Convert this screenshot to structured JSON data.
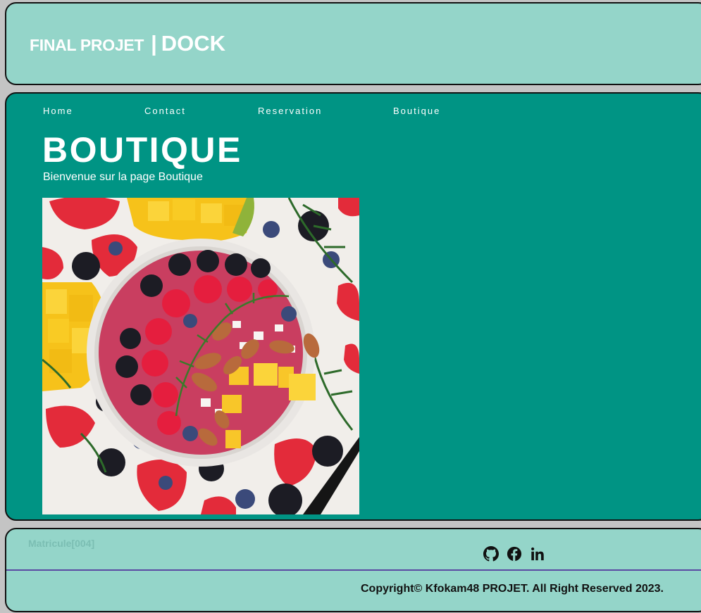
{
  "header": {
    "logo_primary": "FINAL PROJET",
    "logo_separator": "|",
    "logo_secondary": "DOCK"
  },
  "nav": {
    "items": [
      {
        "label": "Home"
      },
      {
        "label": "Contact"
      },
      {
        "label": "Reservation"
      },
      {
        "label": "Boutique"
      }
    ]
  },
  "main": {
    "title": "BOUTIQUE",
    "subtitle": "Bienvenue sur la page Boutique"
  },
  "footer": {
    "matricule": "Matricule[004]",
    "social_icons": [
      "github-icon",
      "facebook-icon",
      "linkedin-icon"
    ],
    "copyright": "Copyright© Kfokam48 PROJET. All Right Reserved 2023."
  },
  "colors": {
    "header_bg": "#94d5c9",
    "main_bg": "#009484",
    "footer_bg": "#94d5c9",
    "page_bg": "#c4c4c4",
    "divider": "#5b4aa3"
  }
}
